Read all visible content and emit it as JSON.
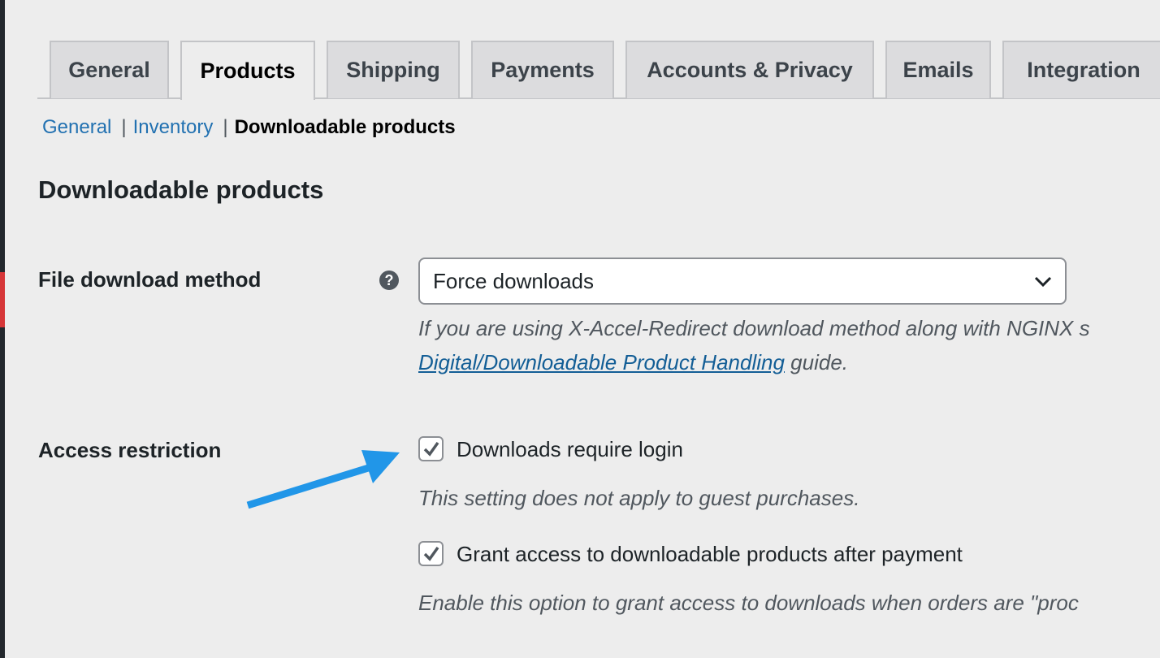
{
  "tabs": [
    {
      "label": "General",
      "active": false
    },
    {
      "label": "Products",
      "active": true
    },
    {
      "label": "Shipping",
      "active": false
    },
    {
      "label": "Payments",
      "active": false
    },
    {
      "label": "Accounts & Privacy",
      "active": false
    },
    {
      "label": "Emails",
      "active": false
    },
    {
      "label": "Integration",
      "active": false
    }
  ],
  "subnav": {
    "items": [
      "General",
      "Inventory"
    ],
    "separator": "|",
    "current": "Downloadable products"
  },
  "section_title": "Downloadable products",
  "file_download": {
    "label": "File download method",
    "help_icon": "question-circle-icon",
    "value": "Force downloads",
    "desc_line1": "If you are using X-Accel-Redirect download method along with NGINX s",
    "desc_link": "Digital/Downloadable Product Handling",
    "desc_after": " guide."
  },
  "access": {
    "label": "Access restriction",
    "require_login": {
      "label": "Downloads require login",
      "checked": true,
      "desc": "This setting does not apply to guest purchases."
    },
    "grant_access": {
      "label": "Grant access to downloadable products after payment",
      "checked": true,
      "desc": "Enable this option to grant access to downloads when orders are \"proc"
    }
  },
  "colors": {
    "arrow": "#2196e8",
    "link": "#2271b1"
  }
}
